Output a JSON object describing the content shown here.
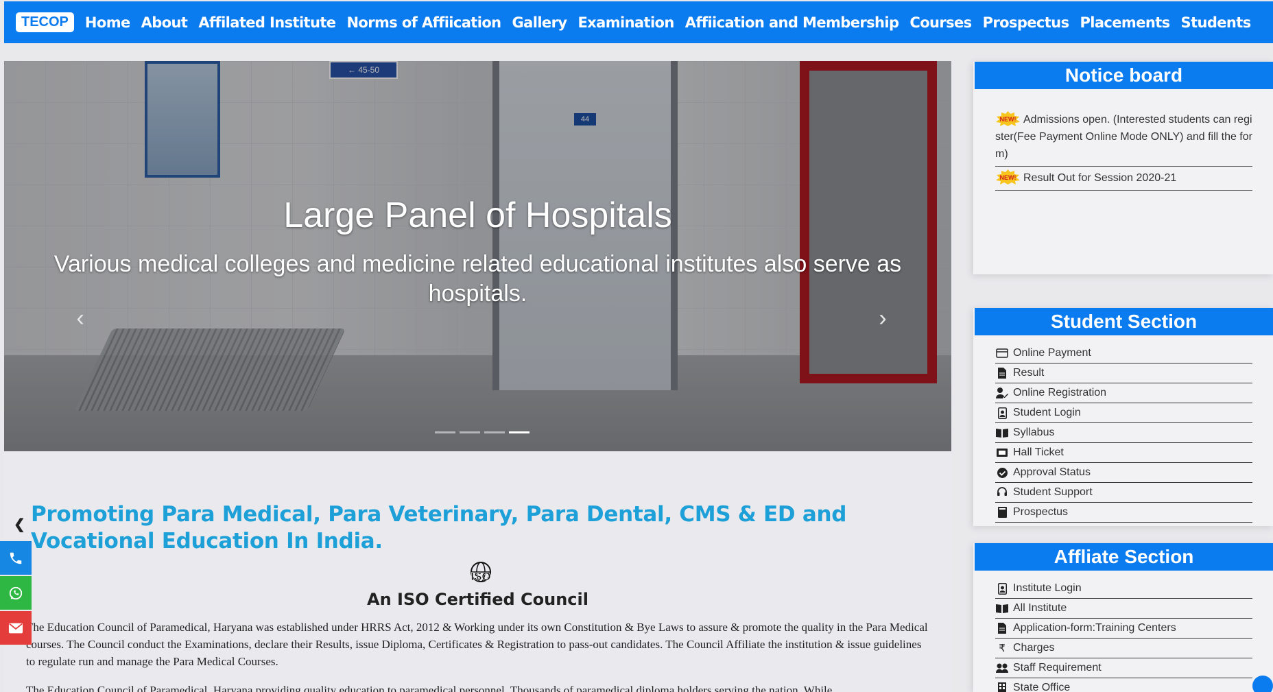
{
  "navbar": {
    "brand": "TECOP",
    "links": [
      "Home",
      "About",
      "Affilated Institute",
      "Norms of Affiication",
      "Gallery",
      "Examination",
      "Affiication and Membership",
      "Courses",
      "Prospectus",
      "Placements",
      "Students"
    ]
  },
  "carousel": {
    "title": "Large Panel of Hospitals",
    "text": "Various medical colleges and medicine related educational institutes also serve as hospitals.",
    "door_number": "44",
    "sign_text": "← 45-50",
    "active_index": 3,
    "slide_count": 4
  },
  "main": {
    "title": "Promoting Para Medical, Para Veterinary, Para Dental, CMS & ED and Vocational Education In India.",
    "iso_logo_text": "ISO",
    "iso_subtitle": "An ISO Certified Council",
    "paragraph1": "The Education Council of Paramedical, Haryana was established under HRRS Act, 2012 & Working under its own Constitution & Bye Laws to assure & promote the quality in the Para Medical courses. The Council conduct the Examinations, declare their Results, issue Diploma, Certificates & Registration to pass-out candidates. The Council Affiliate the institution & issue guidelines to regulate run and manage the Para Medical Courses.",
    "paragraph2": "The Education Council of Paramedical, Haryana providing quality education to paramedical personnel. Thousands of paramedical diploma holders serving the nation. While"
  },
  "notice_board": {
    "title": "Notice board",
    "badge_text": "NEW!",
    "items": [
      "Admissions open. (Interested students can register(Fee Payment Online Mode ONLY) and fill the form)",
      "Result Out for Session 2020-21"
    ]
  },
  "student_section": {
    "title": "Student Section",
    "items": [
      {
        "label": "Online Payment",
        "icon": "credit-card-icon"
      },
      {
        "label": "Result",
        "icon": "file-icon"
      },
      {
        "label": "Online Registration",
        "icon": "user-edit-icon"
      },
      {
        "label": "Student Login",
        "icon": "id-badge-icon"
      },
      {
        "label": "Syllabus",
        "icon": "book-open-icon"
      },
      {
        "label": "Hall Ticket",
        "icon": "ticket-icon"
      },
      {
        "label": "Approval Status",
        "icon": "check-circle-icon"
      },
      {
        "label": "Student Support",
        "icon": "headset-icon"
      },
      {
        "label": "Prospectus",
        "icon": "book-icon"
      }
    ]
  },
  "affiliate_section": {
    "title": "Affliate Section",
    "items": [
      {
        "label": "Institute Login",
        "icon": "id-badge-icon"
      },
      {
        "label": "All Institute",
        "icon": "book-open-icon"
      },
      {
        "label": "Application-form:Training Centers",
        "icon": "file-icon"
      },
      {
        "label": "Charges",
        "icon": "rupee-icon"
      },
      {
        "label": "Staff Requirement",
        "icon": "users-icon"
      },
      {
        "label": "State Office",
        "icon": "building-icon"
      }
    ]
  },
  "colors": {
    "primary": "#0b7bf0",
    "title_blue": "#1d9fd8",
    "phone": "#1688e4",
    "whatsapp": "#2fb743",
    "mail": "#e43b3b"
  }
}
